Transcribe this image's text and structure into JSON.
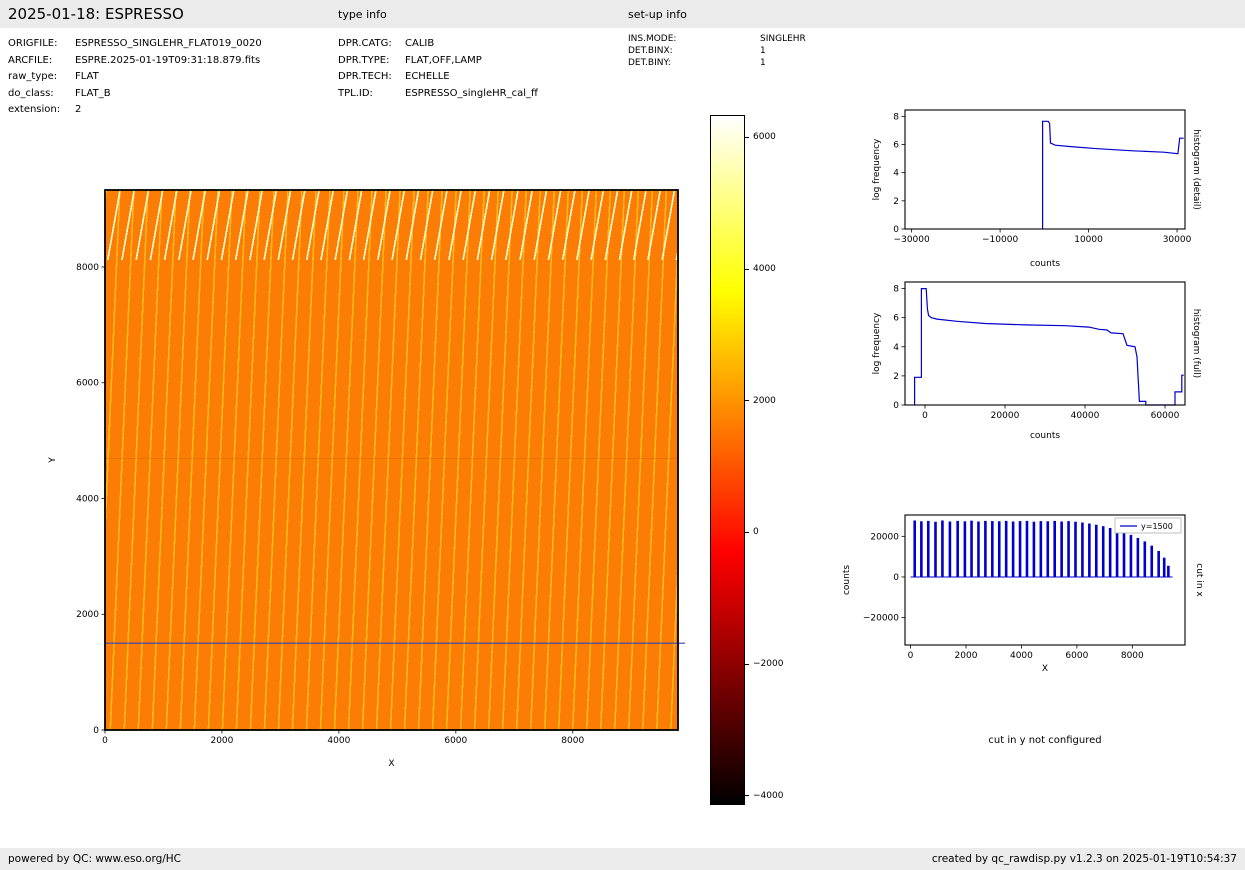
{
  "header": {
    "title": "2025-01-18: ESPRESSO",
    "type_info_label": "type info",
    "setup_info_label": "set-up info"
  },
  "file_info": {
    "rows": [
      {
        "label": "ORIGFILE:",
        "value": "ESPRESSO_SINGLEHR_FLAT019_0020"
      },
      {
        "label": "ARCFILE:",
        "value": "ESPRE.2025-01-19T09:31:18.879.fits"
      },
      {
        "label": "raw_type:",
        "value": "FLAT"
      },
      {
        "label": "do_class:",
        "value": "FLAT_B"
      },
      {
        "label": "extension:",
        "value": "2"
      }
    ]
  },
  "type_info": {
    "rows": [
      {
        "label": "DPR.CATG:",
        "value": "CALIB"
      },
      {
        "label": "DPR.TYPE:",
        "value": "FLAT,OFF,LAMP"
      },
      {
        "label": "DPR.TECH:",
        "value": "ECHELLE"
      },
      {
        "label": "TPL.ID:",
        "value": "ESPRESSO_singleHR_cal_ff"
      }
    ]
  },
  "setup_info": {
    "rows": [
      {
        "label": "INS.MODE:",
        "value": "SINGLEHR"
      },
      {
        "label": "DET.BINX:",
        "value": "1"
      },
      {
        "label": "DET.BINY:",
        "value": "1"
      }
    ]
  },
  "notes": {
    "cut_in_y": "cut in y not configured"
  },
  "footer": {
    "left": "powered by QC: www.eso.org/HC",
    "right": "created by qc_rawdisp.py v1.2.3 on 2025-01-19T10:54:37"
  },
  "chart_data": [
    {
      "id": "raw-image",
      "type": "heatmap",
      "xlabel": "X",
      "ylabel": "Y",
      "xlim": [
        0,
        9800
      ],
      "ylim": [
        0,
        9330
      ],
      "xticks": [
        0,
        2000,
        4000,
        6000,
        8000
      ],
      "yticks": [
        0,
        2000,
        4000,
        6000,
        8000
      ],
      "colormap": "hot",
      "description": "ESPRESSO raw flat-field frame: ~40 slightly tilted vertical echelle-order stripes at ~1500-2000 counts (orange) with bright yellow dashed arcs near the top edge; a horizontal blue cursor line marks the row used for the cut plot",
      "cut_line": {
        "y": 1500,
        "color": "#3344bb"
      },
      "colorbar": {
        "vmin": -4140,
        "vmax": 6340,
        "ticks": [
          6000,
          4000,
          2000,
          0,
          -2000,
          -4000
        ]
      }
    },
    {
      "id": "hist-detail",
      "type": "line",
      "right_label": "histogram (detail)",
      "xlabel": "counts",
      "ylabel": "log frequency",
      "xlim": [
        -31500,
        31800
      ],
      "ylim": [
        0,
        8.45
      ],
      "xticks": [
        -30000,
        -10000,
        10000,
        30000
      ],
      "yticks": [
        0,
        2,
        4,
        6,
        8
      ],
      "grid": false,
      "series": [
        {
          "name": "histogram-detail",
          "color": "#0000cc",
          "points": [
            [
              -400,
              0
            ],
            [
              -400,
              7.65
            ],
            [
              900,
              7.65
            ],
            [
              1200,
              7.5
            ],
            [
              1400,
              6.1
            ],
            [
              2500,
              5.95
            ],
            [
              6000,
              5.85
            ],
            [
              12000,
              5.7
            ],
            [
              20000,
              5.55
            ],
            [
              27000,
              5.45
            ],
            [
              30200,
              5.35
            ],
            [
              30600,
              6.45
            ],
            [
              31500,
              6.45
            ]
          ]
        }
      ]
    },
    {
      "id": "hist-full",
      "type": "line",
      "right_label": "histogram (full)",
      "xlabel": "counts",
      "ylabel": "log frequency",
      "xlim": [
        -5000,
        65000
      ],
      "ylim": [
        0,
        8.45
      ],
      "xticks": [
        0,
        20000,
        40000,
        60000
      ],
      "yticks": [
        0,
        2,
        4,
        6,
        8
      ],
      "grid": false,
      "series": [
        {
          "name": "histogram-full",
          "color": "#0000cc",
          "points": [
            [
              -2600,
              0
            ],
            [
              -2600,
              1.9
            ],
            [
              -900,
              1.9
            ],
            [
              -900,
              8.0
            ],
            [
              300,
              8.0
            ],
            [
              600,
              6.6
            ],
            [
              900,
              6.15
            ],
            [
              1600,
              6.0
            ],
            [
              3000,
              5.9
            ],
            [
              8000,
              5.75
            ],
            [
              15000,
              5.6
            ],
            [
              25000,
              5.5
            ],
            [
              35000,
              5.45
            ],
            [
              41000,
              5.35
            ],
            [
              43500,
              5.2
            ],
            [
              45500,
              5.15
            ],
            [
              46500,
              4.95
            ],
            [
              49500,
              4.9
            ],
            [
              50500,
              4.1
            ],
            [
              52500,
              4.0
            ],
            [
              53000,
              3.3
            ],
            [
              53600,
              0.25
            ],
            [
              55200,
              0.25
            ],
            [
              55200,
              0
            ],
            [
              62500,
              0
            ],
            [
              62500,
              0.9
            ],
            [
              64200,
              0.9
            ],
            [
              64200,
              2.05
            ],
            [
              64700,
              2.05
            ]
          ]
        }
      ]
    },
    {
      "id": "cut-x",
      "type": "bar",
      "right_label": "cut in x",
      "xlabel": "X",
      "ylabel": "counts",
      "legend": "y=1500",
      "xlim": [
        -200,
        9900
      ],
      "ylim": [
        -33500,
        30500
      ],
      "xticks": [
        0,
        2000,
        4000,
        6000,
        8000
      ],
      "yticks": [
        20000,
        0,
        -20000
      ],
      "grid": false,
      "series": [
        {
          "name": "y=1500",
          "color": "#0000cc",
          "bars": [
            [
              150,
              27800
            ],
            [
              390,
              27400
            ],
            [
              640,
              27600
            ],
            [
              900,
              27200
            ],
            [
              1150,
              27800
            ],
            [
              1420,
              27300
            ],
            [
              1700,
              27600
            ],
            [
              1960,
              27400
            ],
            [
              2200,
              27700
            ],
            [
              2450,
              27300
            ],
            [
              2700,
              27600
            ],
            [
              2950,
              27500
            ],
            [
              3200,
              27400
            ],
            [
              3450,
              27600
            ],
            [
              3700,
              27300
            ],
            [
              3950,
              27500
            ],
            [
              4200,
              27600
            ],
            [
              4450,
              27200
            ],
            [
              4700,
              27500
            ],
            [
              4950,
              27400
            ],
            [
              5200,
              27600
            ],
            [
              5450,
              27300
            ],
            [
              5700,
              27500
            ],
            [
              5950,
              27200
            ],
            [
              6200,
              26800
            ],
            [
              6450,
              26300
            ],
            [
              6700,
              25700
            ],
            [
              6950,
              25000
            ],
            [
              7200,
              24100
            ],
            [
              7450,
              23100
            ],
            [
              7700,
              22000
            ],
            [
              7950,
              20700
            ],
            [
              8200,
              19200
            ],
            [
              8450,
              17500
            ],
            [
              8700,
              15400
            ],
            [
              8950,
              12800
            ],
            [
              9150,
              9500
            ],
            [
              9300,
              5500
            ]
          ]
        }
      ]
    }
  ]
}
